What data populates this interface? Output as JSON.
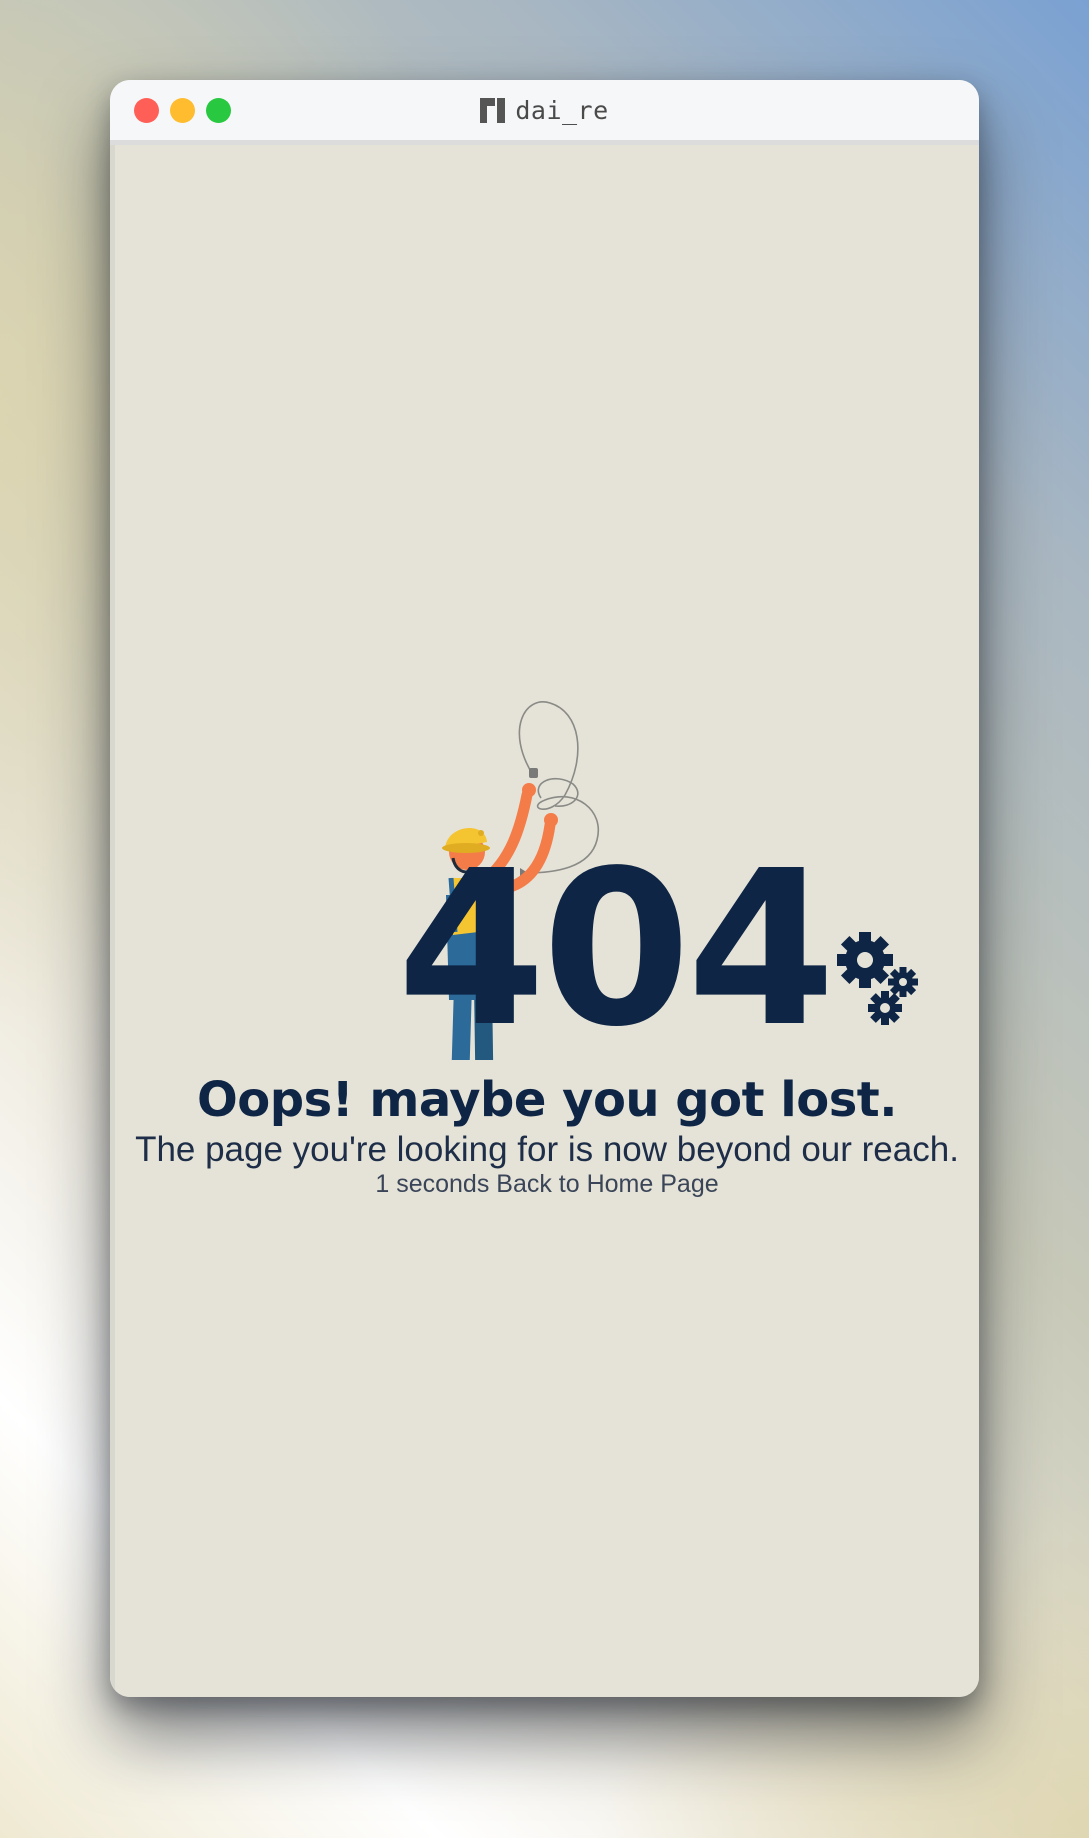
{
  "window": {
    "title": "dai_re",
    "icon": "manjaro-icon",
    "controls": [
      "close",
      "minimize",
      "maximize"
    ]
  },
  "error": {
    "code": "404",
    "heading": "Oops! maybe you got lost.",
    "message": "The page you're looking for is now beyond our reach.",
    "countdown_value": "1 seconds",
    "back_link": "Back to Home Page"
  },
  "colors": {
    "primary": "#0e2545",
    "page_bg": "#e5e3d8",
    "helmet": "#f5c431",
    "overalls": "#2b6a99",
    "skin": "#f47c48"
  }
}
